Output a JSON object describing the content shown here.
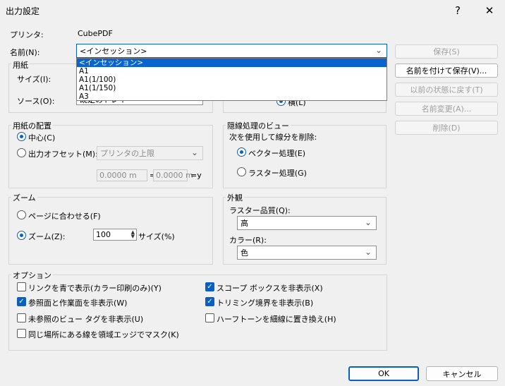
{
  "window": {
    "title": "出力設定",
    "help_label": "?",
    "close_label": "✕"
  },
  "printer": {
    "label": "プリンタ:",
    "value": "CubePDF"
  },
  "name": {
    "label": "名前(N):",
    "value": "<インセッション>",
    "options": [
      "<インセッション>",
      "A1",
      "A1(1/100)",
      "A1(1/150)",
      "A3"
    ]
  },
  "right_buttons": {
    "save": "保存(S)",
    "save_as": "名前を付けて保存(V)...",
    "revert": "以前の状態に戻す(T)",
    "rename": "名前変更(A)...",
    "delete": "削除(D)"
  },
  "paper": {
    "title": "用紙",
    "size_label": "サイズ(I):",
    "source_label": "ソース(O):",
    "source_value": "既定のトレイ"
  },
  "orientation_partial": {
    "value": "横(L)"
  },
  "paper_placement": {
    "title": "用紙の配置",
    "center": "中心(C)",
    "offset": "出力オフセット(M):",
    "offset_from": "プリンタの上限",
    "x_value": "0.0000 m",
    "x_suffix": "=x",
    "y_value": "0.0000 m",
    "y_suffix": "=y"
  },
  "hidden_line": {
    "title": "隠線処理のビュー",
    "subtitle": "次を使用して線分を削除:",
    "vector": "ベクター処理(E)",
    "raster": "ラスター処理(G)"
  },
  "zoom": {
    "title": "ズーム",
    "fit": "ページに合わせる(F)",
    "zoom": "ズーム(Z):",
    "value": "100",
    "suffix": "サイズ(%)"
  },
  "appearance": {
    "title": "外観",
    "raster_quality_label": "ラスター品質(Q):",
    "raster_quality_value": "高",
    "color_label": "カラー(R):",
    "color_value": "色"
  },
  "options": {
    "title": "オプション",
    "blue_links": "リンクを青で表示(カラー印刷のみ)(Y)",
    "hide_ref_planes": "参照面と作業面を非表示(W)",
    "hide_unref_tags": "未参照のビュー タグを非表示(U)",
    "mask_coincident": "同じ場所にある線を領域エッジでマスク(K)",
    "hide_scope_boxes": "スコープ ボックスを非表示(X)",
    "hide_crop": "トリミング境界を非表示(B)",
    "halftone_thin": "ハーフトーンを細線に置き換え(H)"
  },
  "footer": {
    "ok": "OK",
    "cancel": "キャンセル"
  },
  "colors": {
    "accent": "#0a5fc4",
    "selection": "#0a64d0"
  }
}
